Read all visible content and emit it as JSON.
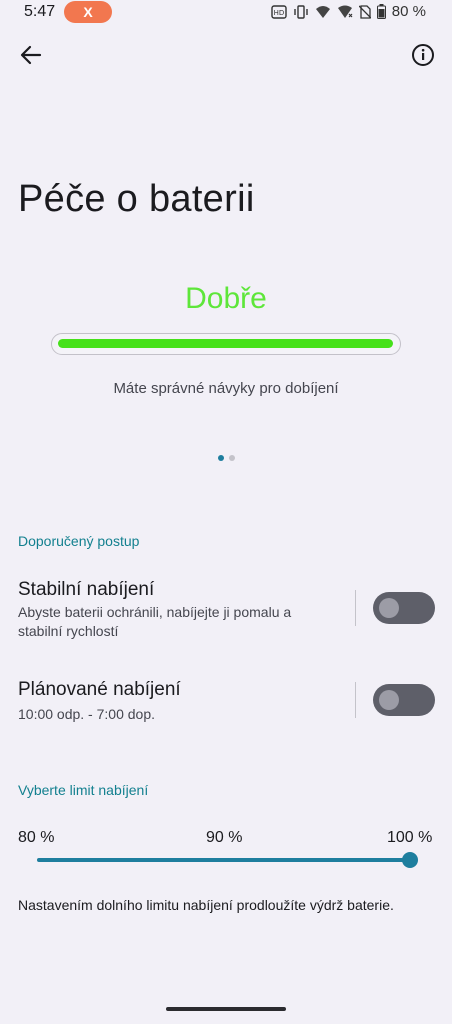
{
  "status_bar": {
    "time": "5:47",
    "app_badge": "X",
    "battery_percent": "80 %",
    "icons": [
      "hd-call-icon",
      "vibrate-icon",
      "wifi-icon",
      "signal-icon",
      "no-sim-icon",
      "battery-icon"
    ]
  },
  "app_bar": {
    "back_icon": "arrow-back-icon",
    "info_icon": "info-icon"
  },
  "page": {
    "title": "Péče o baterii",
    "health_status": "Dobře",
    "health_status_color": "#5ee63a",
    "health_level": 1.0,
    "health_caption": "Máte správné návyky pro dobíjení",
    "pager": {
      "count": 2,
      "active_index": 0
    }
  },
  "recommended": {
    "section_label": "Doporučený postup",
    "stable_charging": {
      "title": "Stabilní nabíjení",
      "subtitle": "Abyste baterii ochránili, nabíjejte ji pomalu a stabilní rychlostí",
      "enabled": false
    },
    "scheduled_charging": {
      "title": "Plánované nabíjení",
      "subtitle": "10:00 odp. - 7:00 dop.",
      "enabled": false
    }
  },
  "limit": {
    "section_label": "Vyberte limit nabíjení",
    "options": [
      "80 %",
      "90 %",
      "100 %"
    ],
    "selected": "100 %",
    "slider_fraction": 1.0,
    "footer": "Nastavením dolního limitu nabíjení prodloužíte výdrž baterie."
  },
  "colors": {
    "accent": "#1e7e9e",
    "section_label": "#13808f",
    "health_bar": "#46e11a",
    "background": "#f2f0f7"
  }
}
